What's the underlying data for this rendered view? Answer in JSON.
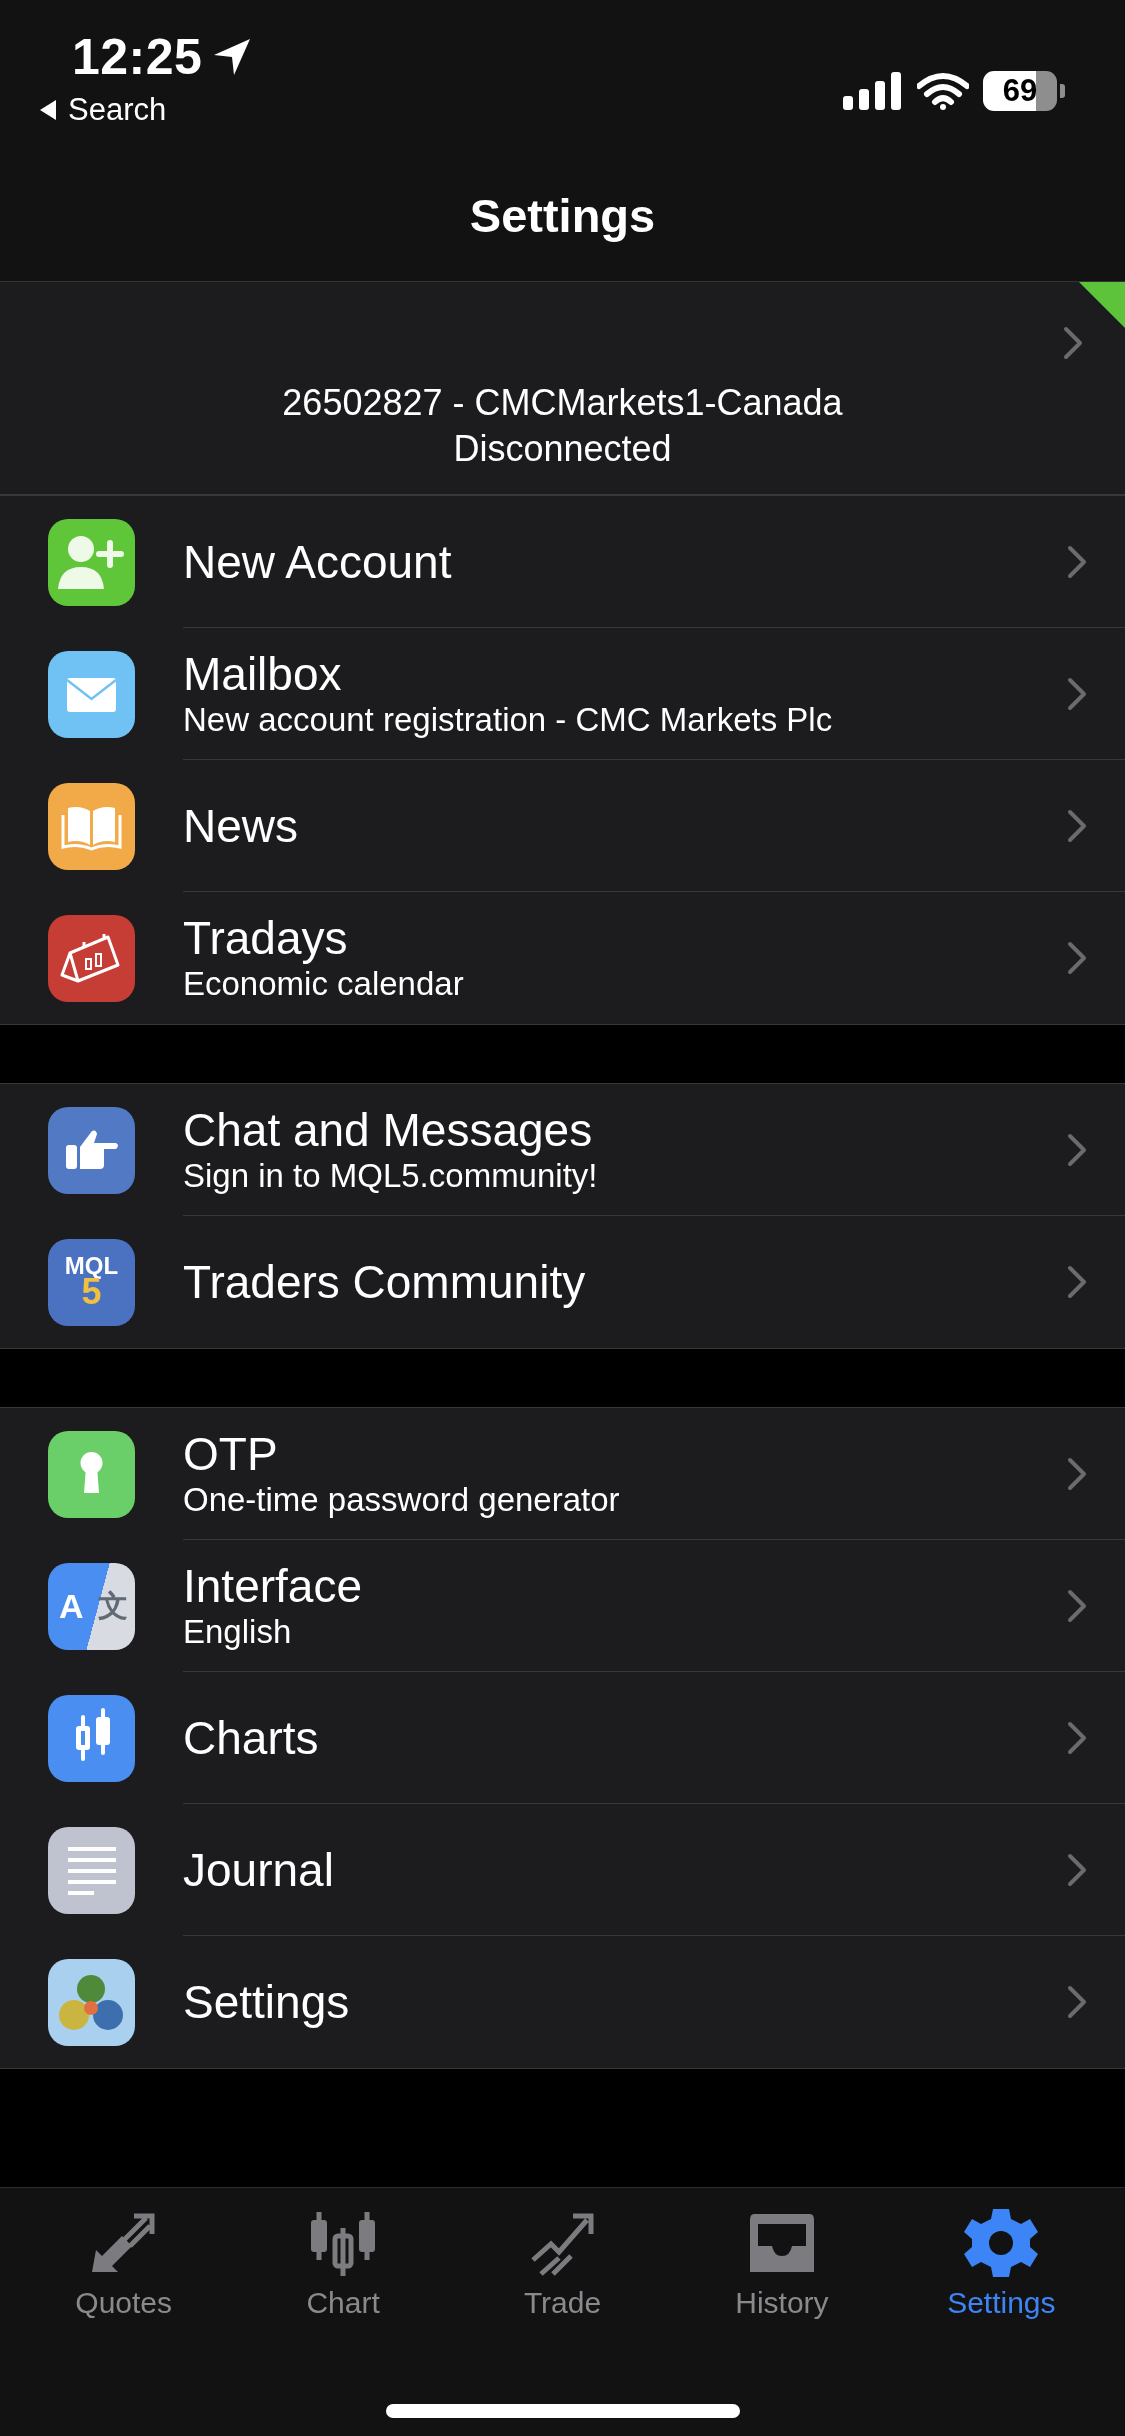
{
  "status_bar": {
    "time": "12:25",
    "back": "Search",
    "battery": "69"
  },
  "header": {
    "title": "Settings"
  },
  "account": {
    "number_server": "26502827 - CMCMarkets1-Canada",
    "status": "Disconnected"
  },
  "sections": [
    {
      "items": [
        {
          "title": "New Account"
        },
        {
          "title": "Mailbox",
          "subtitle": "New account registration - CMC Markets Plc"
        },
        {
          "title": "News"
        },
        {
          "title": "Tradays",
          "subtitle": "Economic calendar"
        }
      ]
    },
    {
      "items": [
        {
          "title": "Chat and Messages",
          "subtitle": "Sign in to MQL5.community!"
        },
        {
          "title": "Traders Community",
          "logo": [
            "MQL",
            "5"
          ]
        }
      ]
    },
    {
      "items": [
        {
          "title": "OTP",
          "subtitle": "One-time password generator"
        },
        {
          "title": "Interface",
          "subtitle": "English",
          "logo": [
            "A",
            "文"
          ]
        },
        {
          "title": "Charts"
        },
        {
          "title": "Journal"
        },
        {
          "title": "Settings"
        }
      ]
    }
  ],
  "tabs": [
    {
      "label": "Quotes",
      "selected": false
    },
    {
      "label": "Chart",
      "selected": false
    },
    {
      "label": "Trade",
      "selected": false
    },
    {
      "label": "History",
      "selected": false
    },
    {
      "label": "Settings",
      "selected": true
    }
  ]
}
